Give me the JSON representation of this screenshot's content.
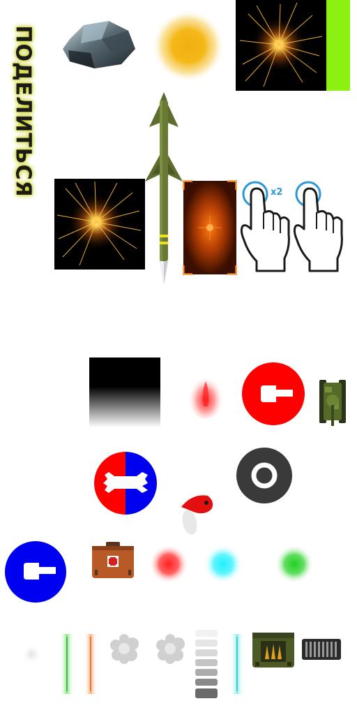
{
  "share_label": "ПОДЕЛИТЬСЯ",
  "double_tap_label": "x2",
  "colors": {
    "share_glow": "#d8e020",
    "sparkle_bg": "#000000",
    "lime_strip": "#8cf010",
    "target_orange": "#ff7a10",
    "team_red": "#ff0000",
    "team_blue": "#0000f0",
    "tap_ring": "#2a98d8",
    "dark_disc": "#3a3a3a",
    "glow_red": "#ff2020",
    "glow_cyan": "#20f0ff",
    "glow_green": "#20d020"
  },
  "icons": {
    "rock": "rock-icon",
    "sun_glow": "sun-glow-icon",
    "missile": "missile-icon",
    "target_reticle": "target-reticle-icon",
    "tap_hand": "tap-hand-icon",
    "tank_turret": "tank-turret-icon",
    "tank_top": "tank-top-icon",
    "wrench": "wrench-icon",
    "location_pin": "location-pin-icon",
    "aim_ring": "aim-ring-icon",
    "medkit": "medkit-icon",
    "smoke_puff": "smoke-puff-icon",
    "ammo_box": "ammo-box-icon",
    "ammo_clip": "ammo-clip-icon"
  }
}
